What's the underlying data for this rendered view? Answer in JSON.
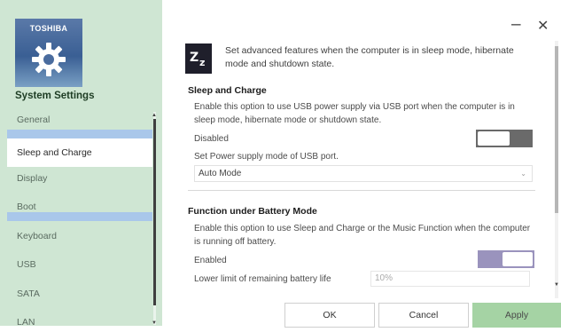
{
  "brand": {
    "logo_text": "TOSHIBA"
  },
  "sidebar": {
    "title": "System Settings",
    "items": [
      {
        "label": "General"
      },
      {
        "label": "Sleep and Charge",
        "selected": true
      },
      {
        "label": "Display"
      },
      {
        "label": "Boot"
      },
      {
        "label": "Keyboard"
      },
      {
        "label": "USB"
      },
      {
        "label": "SATA"
      },
      {
        "label": "LAN"
      }
    ]
  },
  "window": {
    "minimize": "–",
    "close": "✕"
  },
  "header": {
    "icon": "sleep-zz-icon",
    "description": "Set advanced features when the computer is in sleep mode, hibernate mode and shutdown state."
  },
  "sleep_and_charge": {
    "title": "Sleep and Charge",
    "description": "Enable this option to use USB power supply via USB port when the computer is in sleep mode, hibernate mode or shutdown state.",
    "state_label": "Disabled",
    "enabled": false,
    "mode_label": "Set Power supply mode of USB port.",
    "mode_value": "Auto Mode"
  },
  "battery_mode": {
    "title": "Function under Battery Mode",
    "description": "Enable this option to use Sleep and Charge or the Music Function when the computer is running off battery.",
    "state_label": "Enabled",
    "enabled": true,
    "limit_label": "Lower limit of remaining battery life",
    "limit_value": "10%"
  },
  "buttons": {
    "ok": "OK",
    "cancel": "Cancel",
    "apply": "Apply"
  },
  "colors": {
    "sidebar_bg": "#cfe6d3",
    "nav_highlight": "#a9c7ea",
    "apply_button": "#a5d3a4",
    "toggle_on": "#9a93bd",
    "toggle_off": "#6a6a6a"
  }
}
